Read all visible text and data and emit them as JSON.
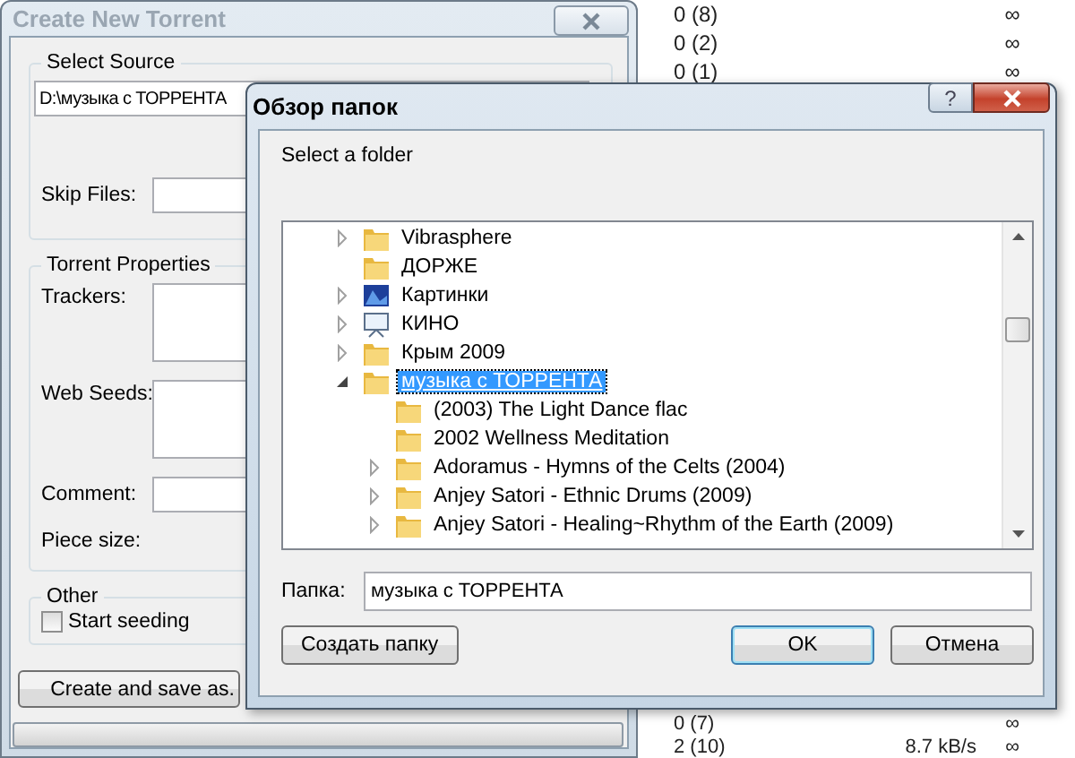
{
  "background_list": {
    "top_rows": [
      {
        "peers": "0 (8)",
        "speed": "",
        "limit": "∞"
      },
      {
        "peers": "0 (2)",
        "speed": "",
        "limit": "∞"
      },
      {
        "peers": "0 (1)",
        "speed": "",
        "limit": "∞"
      }
    ],
    "bottom_rows": [
      {
        "peers": "0 (7)",
        "speed": "",
        "limit": "∞"
      },
      {
        "peers": "2 (10)",
        "speed": "8.7 kB/s",
        "limit": "∞"
      }
    ]
  },
  "torrent_window": {
    "title": "Create New Torrent",
    "active": false,
    "source": {
      "legend": "Select Source",
      "path": "D:\\музыка с ТОРРЕНТА",
      "skip_label": "Skip Files:"
    },
    "properties": {
      "legend": "Torrent Properties",
      "trackers_label": "Trackers:",
      "web_seeds_label": "Web Seeds:",
      "comment_label": "Comment:",
      "piece_size_label": "Piece size:"
    },
    "other": {
      "legend": "Other",
      "start_seeding": {
        "label": "Start seeding",
        "checked": false
      }
    },
    "create_button": "Create and save as.",
    "progress": {
      "level": 0
    }
  },
  "folder_dialog": {
    "title": "Обзор папок",
    "help": "?",
    "prompt": "Select a folder",
    "tree": [
      {
        "label": "Vibrasphere",
        "kind": "folder",
        "has_children": true,
        "expanded": false,
        "selected": false
      },
      {
        "label": "ДОРЖЕ",
        "kind": "folder",
        "has_children": false,
        "selected": false
      },
      {
        "label": "Картинки",
        "kind": "pictures",
        "has_children": true,
        "expanded": false,
        "selected": false
      },
      {
        "label": "КИНО",
        "kind": "video",
        "has_children": true,
        "expanded": false,
        "selected": false
      },
      {
        "label": "Крым 2009",
        "kind": "folder",
        "has_children": true,
        "expanded": false,
        "selected": false
      },
      {
        "label": "музыка с ТОРРЕНТА",
        "kind": "folder",
        "has_children": true,
        "expanded": true,
        "selected": true,
        "children": [
          {
            "label": "(2003) The Light Dance flac",
            "kind": "folder",
            "has_children": false,
            "selected": false
          },
          {
            "label": "2002 Wellness Meditation",
            "kind": "folder",
            "has_children": false,
            "selected": false
          },
          {
            "label": "Adoramus - Hymns of the Celts (2004)",
            "kind": "folder",
            "has_children": true,
            "expanded": false,
            "selected": false
          },
          {
            "label": "Anjey Satori - Ethnic Drums (2009)",
            "kind": "folder",
            "has_children": true,
            "expanded": false,
            "selected": false
          },
          {
            "label": "Anjey Satori - Healing~Rhythm of the Earth (2009)",
            "kind": "folder",
            "has_children": true,
            "expanded": false,
            "selected": false
          }
        ]
      }
    ],
    "folder_label": "Папка:",
    "folder_value": "музыка с ТОРРЕНТА",
    "buttons": [
      {
        "label": "Создать папку",
        "kind": "left",
        "default": false
      },
      {
        "label": "OK",
        "kind": "right",
        "default": true
      },
      {
        "label": "Отмена",
        "kind": "right",
        "default": false
      }
    ]
  }
}
